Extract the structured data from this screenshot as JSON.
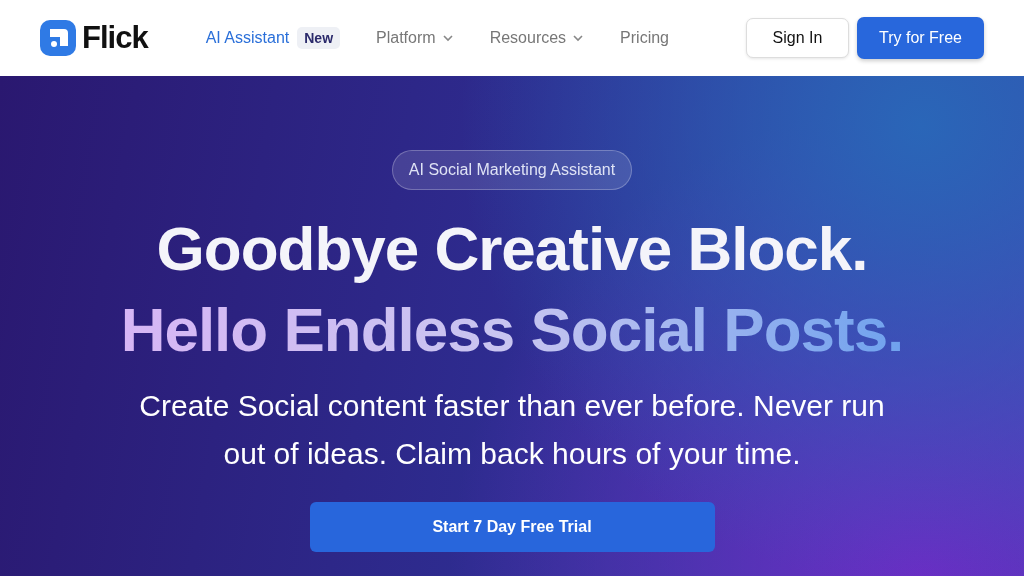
{
  "header": {
    "logo": "Flick",
    "nav": [
      {
        "label": "AI Assistant",
        "badge": "New",
        "dropdown": false,
        "selected": true
      },
      {
        "label": "Platform",
        "dropdown": true,
        "selected": false
      },
      {
        "label": "Resources",
        "dropdown": true,
        "selected": false
      },
      {
        "label": "Pricing",
        "dropdown": false,
        "selected": false
      }
    ],
    "sign_in": "Sign In",
    "try_free": "Try for Free"
  },
  "hero": {
    "tag": "AI Social Marketing Assistant",
    "headline": [
      "Goodbye Creative Block.",
      "Hello Endless Social Posts."
    ],
    "subtitle": "Create Social content faster than ever before. Never run out of ideas. Claim back hours of your time.",
    "cta": "Start 7 Day Free Trial"
  }
}
